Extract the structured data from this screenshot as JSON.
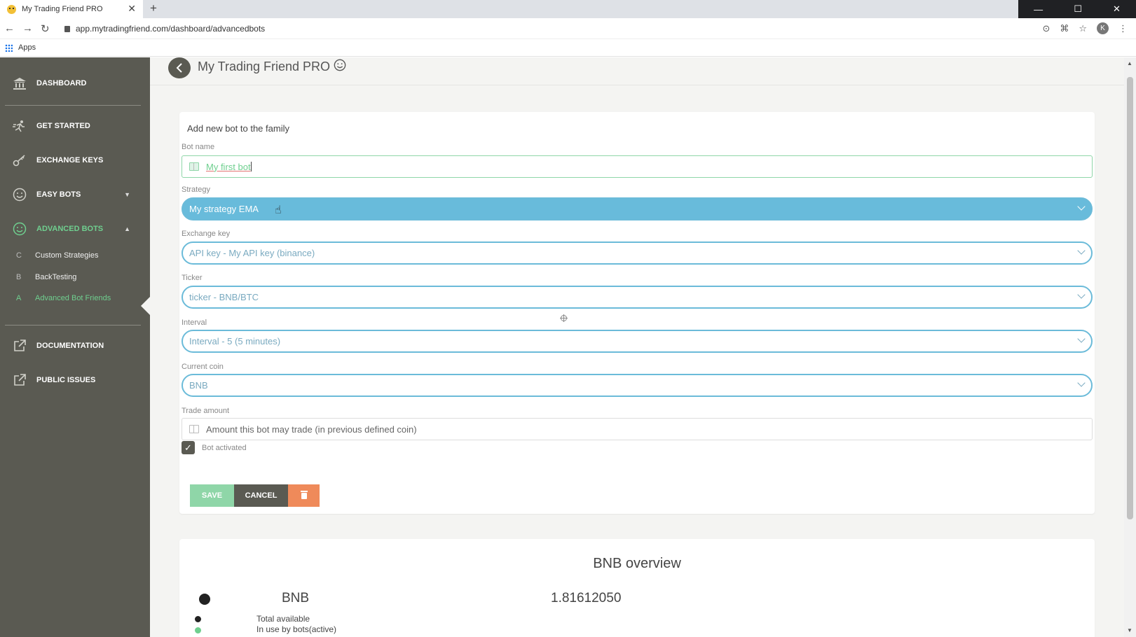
{
  "browser": {
    "tab_title": "My Trading Friend PRO",
    "url": "app.mytradingfriend.com/dashboard/advancedbots",
    "bookmarks_apps_label": "Apps",
    "profile_initial": "K"
  },
  "sidebar": {
    "items": [
      {
        "label": "DASHBOARD",
        "icon": "bank-icon"
      },
      {
        "label": "GET STARTED",
        "icon": "runner-icon"
      },
      {
        "label": "EXCHANGE KEYS",
        "icon": "key-icon"
      },
      {
        "label": "EASY BOTS",
        "icon": "smile-icon"
      },
      {
        "label": "ADVANCED BOTS",
        "icon": "smile-icon"
      },
      {
        "label": "DOCUMENTATION",
        "icon": "external-link-icon"
      },
      {
        "label": "PUBLIC ISSUES",
        "icon": "external-link-icon"
      }
    ],
    "subitems": [
      {
        "letter": "C",
        "label": "Custom Strategies"
      },
      {
        "letter": "B",
        "label": "BackTesting"
      },
      {
        "letter": "A",
        "label": "Advanced Bot Friends"
      }
    ]
  },
  "header": {
    "title": "My Trading Friend PRO"
  },
  "form": {
    "title": "Add new bot to the family",
    "bot_name_label": "Bot name",
    "bot_name_value": "My first bot",
    "strategy_label": "Strategy",
    "strategy_value": "My strategy EMA",
    "exchange_key_label": "Exchange key",
    "exchange_key_value": "API key - My API key (binance)",
    "ticker_label": "Ticker",
    "ticker_value": "ticker - BNB/BTC",
    "interval_label": "Interval",
    "interval_value": "Interval - 5 (5 minutes)",
    "current_coin_label": "Current coin",
    "current_coin_value": "BNB",
    "trade_amount_label": "Trade amount",
    "trade_amount_placeholder": "Amount this bot may trade (in previous defined coin)",
    "bot_activated_label": "Bot activated",
    "bot_activated": true,
    "save_label": "SAVE",
    "cancel_label": "CANCEL"
  },
  "overview": {
    "title": "BNB overview",
    "coin": "BNB",
    "value": "1.81612050",
    "legend": [
      {
        "label": "Total available",
        "color": "#222222"
      },
      {
        "label": "In use by bots(active)",
        "color": "#6fcf8f"
      }
    ]
  },
  "colors": {
    "sidebar_bg": "#5a5a52",
    "accent_green": "#6fcf8f",
    "select_blue": "#68bbdb",
    "delete_orange": "#ef8a5a"
  }
}
